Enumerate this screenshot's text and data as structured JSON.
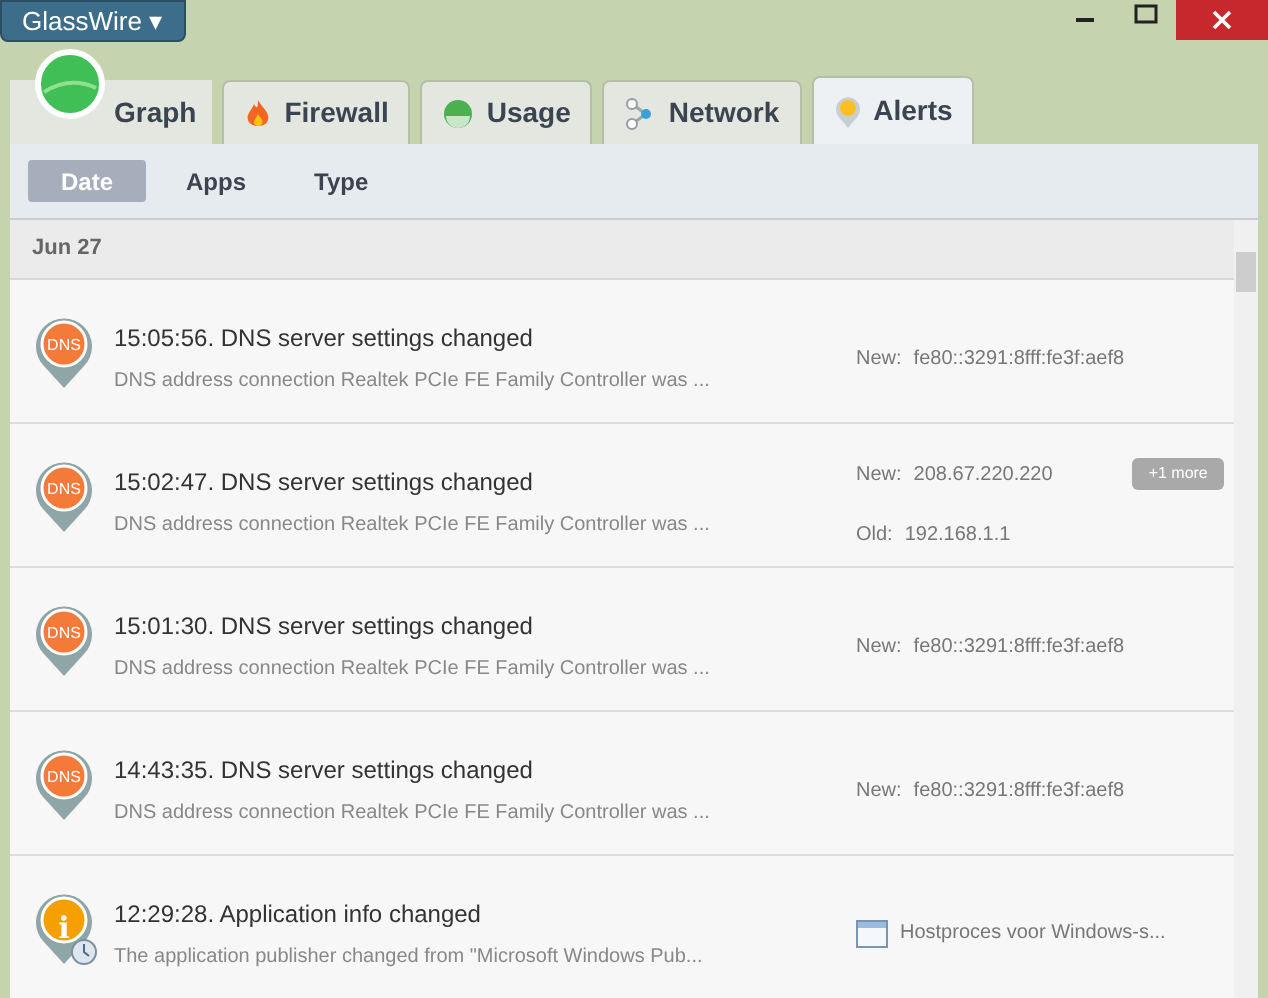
{
  "app_menu": {
    "label": "GlassWire ▾"
  },
  "tabs": [
    {
      "label": "Graph",
      "kind": "graph",
      "selected": false
    },
    {
      "label": "Firewall",
      "kind": "firewall",
      "selected": false
    },
    {
      "label": "Usage",
      "kind": "usage",
      "selected": false
    },
    {
      "label": "Network",
      "kind": "network",
      "selected": false
    },
    {
      "label": "Alerts",
      "kind": "alerts",
      "selected": true
    }
  ],
  "subtabs": [
    {
      "label": "Date",
      "selected": true
    },
    {
      "label": "Apps",
      "selected": false
    },
    {
      "label": "Type",
      "selected": false
    }
  ],
  "date_header": "Jun 27",
  "alerts": [
    {
      "kind": "dns",
      "icon_text": "DNS",
      "title": "15:05:56. DNS server settings changed",
      "description": "DNS address connection Realtek PCIe FE Family Controller was ...",
      "details": [
        {
          "label": "New:",
          "value": "fe80::3291:8fff:fe3f:aef8"
        }
      ]
    },
    {
      "kind": "dns",
      "icon_text": "DNS",
      "title": "15:02:47. DNS server settings changed",
      "description": "DNS address connection Realtek PCIe FE Family Controller was ...",
      "details": [
        {
          "label": "New:",
          "value": "208.67.220.220",
          "badge": "+1 more"
        },
        {
          "label": "Old:",
          "value": "192.168.1.1"
        }
      ]
    },
    {
      "kind": "dns",
      "icon_text": "DNS",
      "title": "15:01:30. DNS server settings changed",
      "description": "DNS address connection Realtek PCIe FE Family Controller was ...",
      "details": [
        {
          "label": "New:",
          "value": "fe80::3291:8fff:fe3f:aef8"
        }
      ]
    },
    {
      "kind": "dns",
      "icon_text": "DNS",
      "title": "14:43:35. DNS server settings changed",
      "description": "DNS address connection Realtek PCIe FE Family Controller was ...",
      "details": [
        {
          "label": "New:",
          "value": "fe80::3291:8fff:fe3f:aef8"
        }
      ]
    },
    {
      "kind": "info",
      "icon_text": "i",
      "title": "12:29:28. Application info changed",
      "description": "The application publisher changed from \"Microsoft Windows Pub...",
      "app": "Hostproces voor Windows-s..."
    }
  ]
}
